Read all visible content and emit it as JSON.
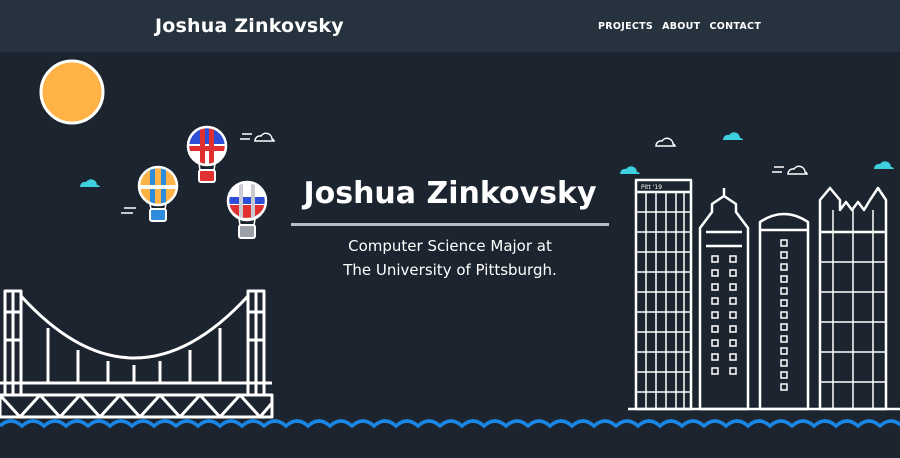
{
  "navbar": {
    "brand": "Joshua Zinkovsky",
    "links": [
      "PROJECTS",
      "ABOUT",
      "CONTACT"
    ]
  },
  "hero": {
    "title": "Joshua Zinkovsky",
    "subtitle_line1": "Computer Science Major at",
    "subtitle_line2": "The University of Pittsburgh."
  },
  "skyline": {
    "building_sign": "Pitt '19"
  },
  "colors": {
    "background": "#1c2430",
    "navbar": "#27323f",
    "sun": "#ffb347",
    "cloud": "#3fd0e0",
    "water": "#1a87e6",
    "line_art": "#ffffff",
    "rule": "#b9bfc6"
  },
  "icons": [
    "sun-icon",
    "hot-air-balloon-icon",
    "cloud-icon",
    "bridge-icon",
    "skyline-icon",
    "wave-icon"
  ]
}
